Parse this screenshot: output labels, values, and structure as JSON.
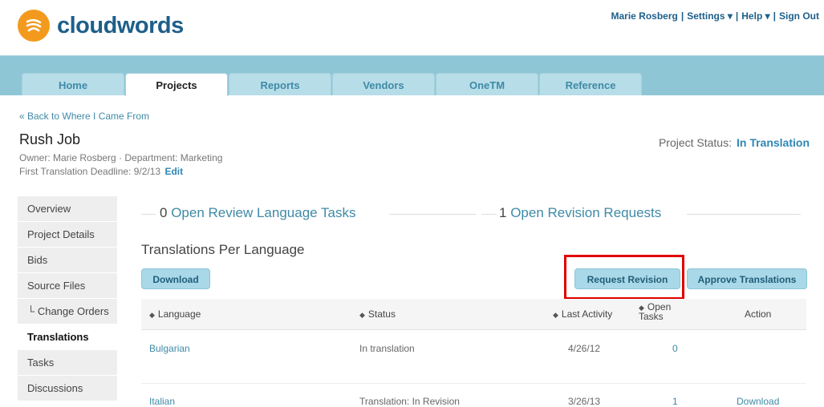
{
  "brand": {
    "name": "cloudwords",
    "logo_color": "#f39a1e",
    "text_color": "#1e5f8a"
  },
  "user_nav": {
    "user": "Marie Rosberg",
    "settings": "Settings ▾",
    "help": "Help ▾",
    "sign_out": "Sign Out",
    "separator": "|"
  },
  "tabs": [
    {
      "label": "Home"
    },
    {
      "label": "Projects",
      "active": true
    },
    {
      "label": "Reports"
    },
    {
      "label": "Vendors"
    },
    {
      "label": "OneTM"
    },
    {
      "label": "Reference"
    }
  ],
  "project": {
    "back_link": "« Back to Where I Came From",
    "title": "Rush Job",
    "meta": "Owner: Marie Rosberg · Department: Marketing",
    "deadline_label": "First Translation Deadline: 9/2/13",
    "edit_label": "Edit",
    "status_label": "Project Status:",
    "status_value": "In Translation"
  },
  "sidebar": {
    "items": [
      {
        "label": "Overview"
      },
      {
        "label": "Project Details"
      },
      {
        "label": "Bids"
      },
      {
        "label": "Source Files"
      },
      {
        "label": "└ Change Orders"
      },
      {
        "label": "Translations",
        "active": true
      },
      {
        "label": "Tasks"
      },
      {
        "label": "Discussions"
      }
    ]
  },
  "summary": {
    "review_count": "0",
    "review_label": "Open Review Language Tasks",
    "revision_count": "1",
    "revision_label": "Open Revision Requests"
  },
  "section_title": "Translations Per Language",
  "buttons": {
    "download": "Download",
    "request_revision": "Request Revision",
    "approve": "Approve Translations"
  },
  "table": {
    "headers": {
      "language": "Language",
      "status": "Status",
      "last_activity": "Last Activity",
      "open_tasks_1": "Open",
      "open_tasks_2": "Tasks",
      "action": "Action"
    },
    "sort_icon": "◆",
    "rows": [
      {
        "language": "Bulgarian",
        "status": "In translation",
        "last_activity": "4/26/12",
        "open_tasks": "0",
        "action": ""
      },
      {
        "language": "Italian",
        "status": "Translation: In Revision",
        "last_activity": "3/26/13",
        "open_tasks": "1",
        "action": "Download"
      }
    ]
  }
}
